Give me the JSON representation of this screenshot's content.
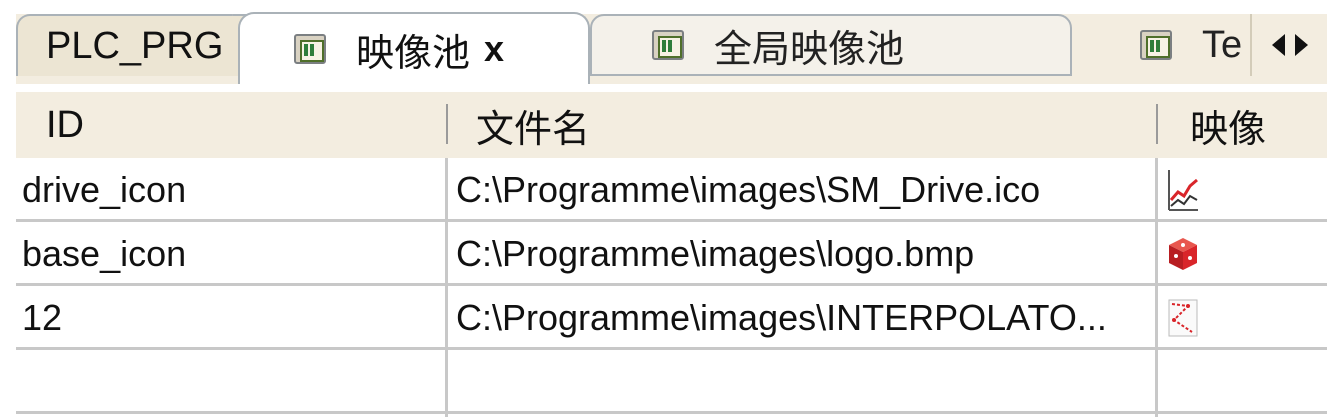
{
  "tabs": [
    {
      "label": "PLC_PRG"
    },
    {
      "label": "映像池",
      "close": "x"
    },
    {
      "label": "全局映像池"
    },
    {
      "label": "Te"
    }
  ],
  "table": {
    "columns": [
      "ID",
      "文件名",
      "映像"
    ],
    "rows": [
      {
        "id": "drive_icon",
        "file": "C:\\Programme\\images\\SM_Drive.ico",
        "image": "drive-chart-thumbnail"
      },
      {
        "id": "base_icon",
        "file": "C:\\Programme\\images\\logo.bmp",
        "image": "red-cube-thumbnail"
      },
      {
        "id": "12",
        "file": "C:\\Programme\\images\\INTERPOLATO...",
        "image": "interpolation-thumbnail"
      },
      {
        "id": "",
        "file": "",
        "image": ""
      }
    ]
  },
  "colors": {
    "tab_bar": "#f3ede0",
    "header": "#f3ede0",
    "grid_line": "#c8c8c8",
    "accent_red": "#d9252a"
  }
}
